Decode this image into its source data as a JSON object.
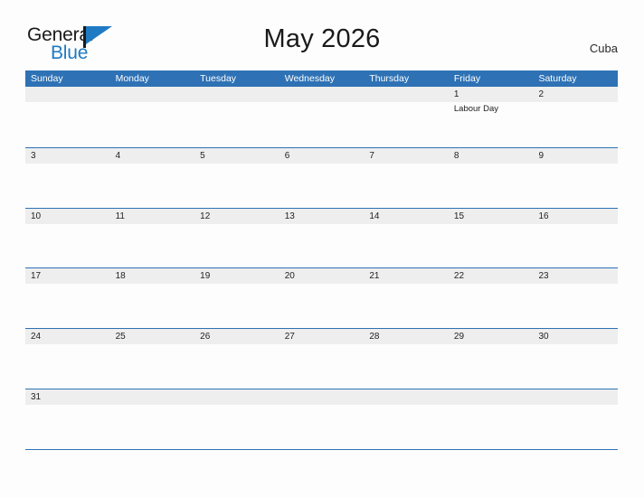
{
  "brand": {
    "name_part1": "General",
    "name_part2": "Blue",
    "flag_icon": "blue-flag-triangle-icon",
    "accent_color": "#1f7ac4"
  },
  "header": {
    "title": "May 2026",
    "country": "Cuba"
  },
  "theme": {
    "header_blue": "#2e72b5",
    "daynum_band_gray": "#eeeeee",
    "page_background": "#fdfdfd",
    "text_color": "#222222"
  },
  "calendar": {
    "month": "May",
    "year": "2026",
    "weekday_headers": [
      "Sunday",
      "Monday",
      "Tuesday",
      "Wednesday",
      "Thursday",
      "Friday",
      "Saturday"
    ],
    "weeks": [
      {
        "days": [
          {
            "date": "",
            "events": []
          },
          {
            "date": "",
            "events": []
          },
          {
            "date": "",
            "events": []
          },
          {
            "date": "",
            "events": []
          },
          {
            "date": "",
            "events": []
          },
          {
            "date": "1",
            "events": [
              "Labour Day"
            ]
          },
          {
            "date": "2",
            "events": []
          }
        ]
      },
      {
        "days": [
          {
            "date": "3",
            "events": []
          },
          {
            "date": "4",
            "events": []
          },
          {
            "date": "5",
            "events": []
          },
          {
            "date": "6",
            "events": []
          },
          {
            "date": "7",
            "events": []
          },
          {
            "date": "8",
            "events": []
          },
          {
            "date": "9",
            "events": []
          }
        ]
      },
      {
        "days": [
          {
            "date": "10",
            "events": []
          },
          {
            "date": "11",
            "events": []
          },
          {
            "date": "12",
            "events": []
          },
          {
            "date": "13",
            "events": []
          },
          {
            "date": "14",
            "events": []
          },
          {
            "date": "15",
            "events": []
          },
          {
            "date": "16",
            "events": []
          }
        ]
      },
      {
        "days": [
          {
            "date": "17",
            "events": []
          },
          {
            "date": "18",
            "events": []
          },
          {
            "date": "19",
            "events": []
          },
          {
            "date": "20",
            "events": []
          },
          {
            "date": "21",
            "events": []
          },
          {
            "date": "22",
            "events": []
          },
          {
            "date": "23",
            "events": []
          }
        ]
      },
      {
        "days": [
          {
            "date": "24",
            "events": []
          },
          {
            "date": "25",
            "events": []
          },
          {
            "date": "26",
            "events": []
          },
          {
            "date": "27",
            "events": []
          },
          {
            "date": "28",
            "events": []
          },
          {
            "date": "29",
            "events": []
          },
          {
            "date": "30",
            "events": []
          }
        ]
      },
      {
        "days": [
          {
            "date": "31",
            "events": []
          },
          {
            "date": "",
            "events": []
          },
          {
            "date": "",
            "events": []
          },
          {
            "date": "",
            "events": []
          },
          {
            "date": "",
            "events": []
          },
          {
            "date": "",
            "events": []
          },
          {
            "date": "",
            "events": []
          }
        ]
      }
    ]
  }
}
